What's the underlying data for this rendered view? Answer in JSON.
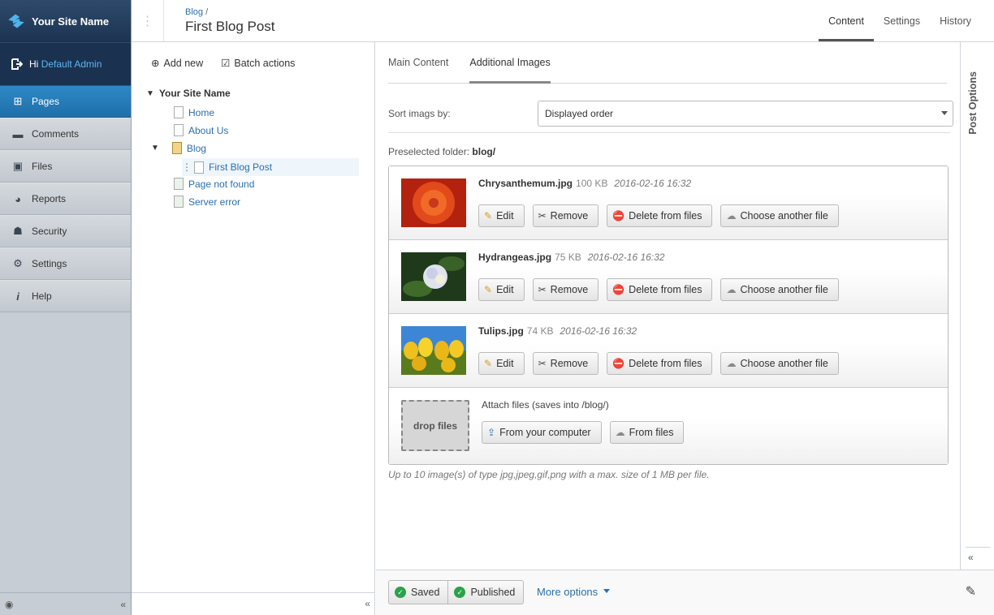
{
  "brand": {
    "name": "Your Site Name",
    "greeting": "Hi",
    "user": "Default Admin"
  },
  "nav": [
    {
      "label": "Pages",
      "icon": "sitemap-icon",
      "active": true
    },
    {
      "label": "Comments",
      "icon": "comment-icon"
    },
    {
      "label": "Files",
      "icon": "image-icon"
    },
    {
      "label": "Reports",
      "icon": "pie-chart-icon"
    },
    {
      "label": "Security",
      "icon": "users-icon"
    },
    {
      "label": "Settings",
      "icon": "gears-icon"
    },
    {
      "label": "Help",
      "icon": "info-icon"
    }
  ],
  "header": {
    "breadcrumb": "Blog",
    "breadcrumb_sep": "/",
    "title": "First Blog Post",
    "tabs": [
      "Content",
      "Settings",
      "History"
    ]
  },
  "tree": {
    "toolbar": {
      "add": "Add new",
      "batch": "Batch actions"
    },
    "root": "Your Site Name",
    "nodes": [
      "Home",
      "About Us",
      "Blog",
      "First Blog Post",
      "Page not found",
      "Server error"
    ]
  },
  "main": {
    "tabs": [
      "Main Content",
      "Additional Images"
    ],
    "sort_label": "Sort imags by:",
    "sort_value": "Displayed order",
    "preselected_label": "Preselected folder:",
    "preselected_value": "blog/",
    "images": [
      {
        "name": "Chrysanthemum.jpg",
        "size": "100 KB",
        "date": "2016-02-16 16:32"
      },
      {
        "name": "Hydrangeas.jpg",
        "size": "75 KB",
        "date": "2016-02-16 16:32"
      },
      {
        "name": "Tulips.jpg",
        "size": "74 KB",
        "date": "2016-02-16 16:32"
      }
    ],
    "buttons": {
      "edit": "Edit",
      "remove": "Remove",
      "delete": "Delete from files",
      "choose": "Choose another file"
    },
    "attach": {
      "drop": "drop files",
      "label": "Attach files (saves into /blog/)",
      "computer": "From your computer",
      "files": "From files"
    },
    "hint": "Up to 10 image(s) of type jpg,jpeg,gif,png with a max. size of 1 MB per file."
  },
  "footer": {
    "saved": "Saved",
    "published": "Published",
    "more": "More options"
  },
  "side": {
    "title": "Post Options",
    "collapse": "«"
  },
  "collapse": "«",
  "colors": {
    "accent": "#2a6faf",
    "nav_active": "#2d89c6",
    "brand_bg": "#1c3452",
    "ok": "#2aa24a",
    "danger": "#d9302c"
  }
}
